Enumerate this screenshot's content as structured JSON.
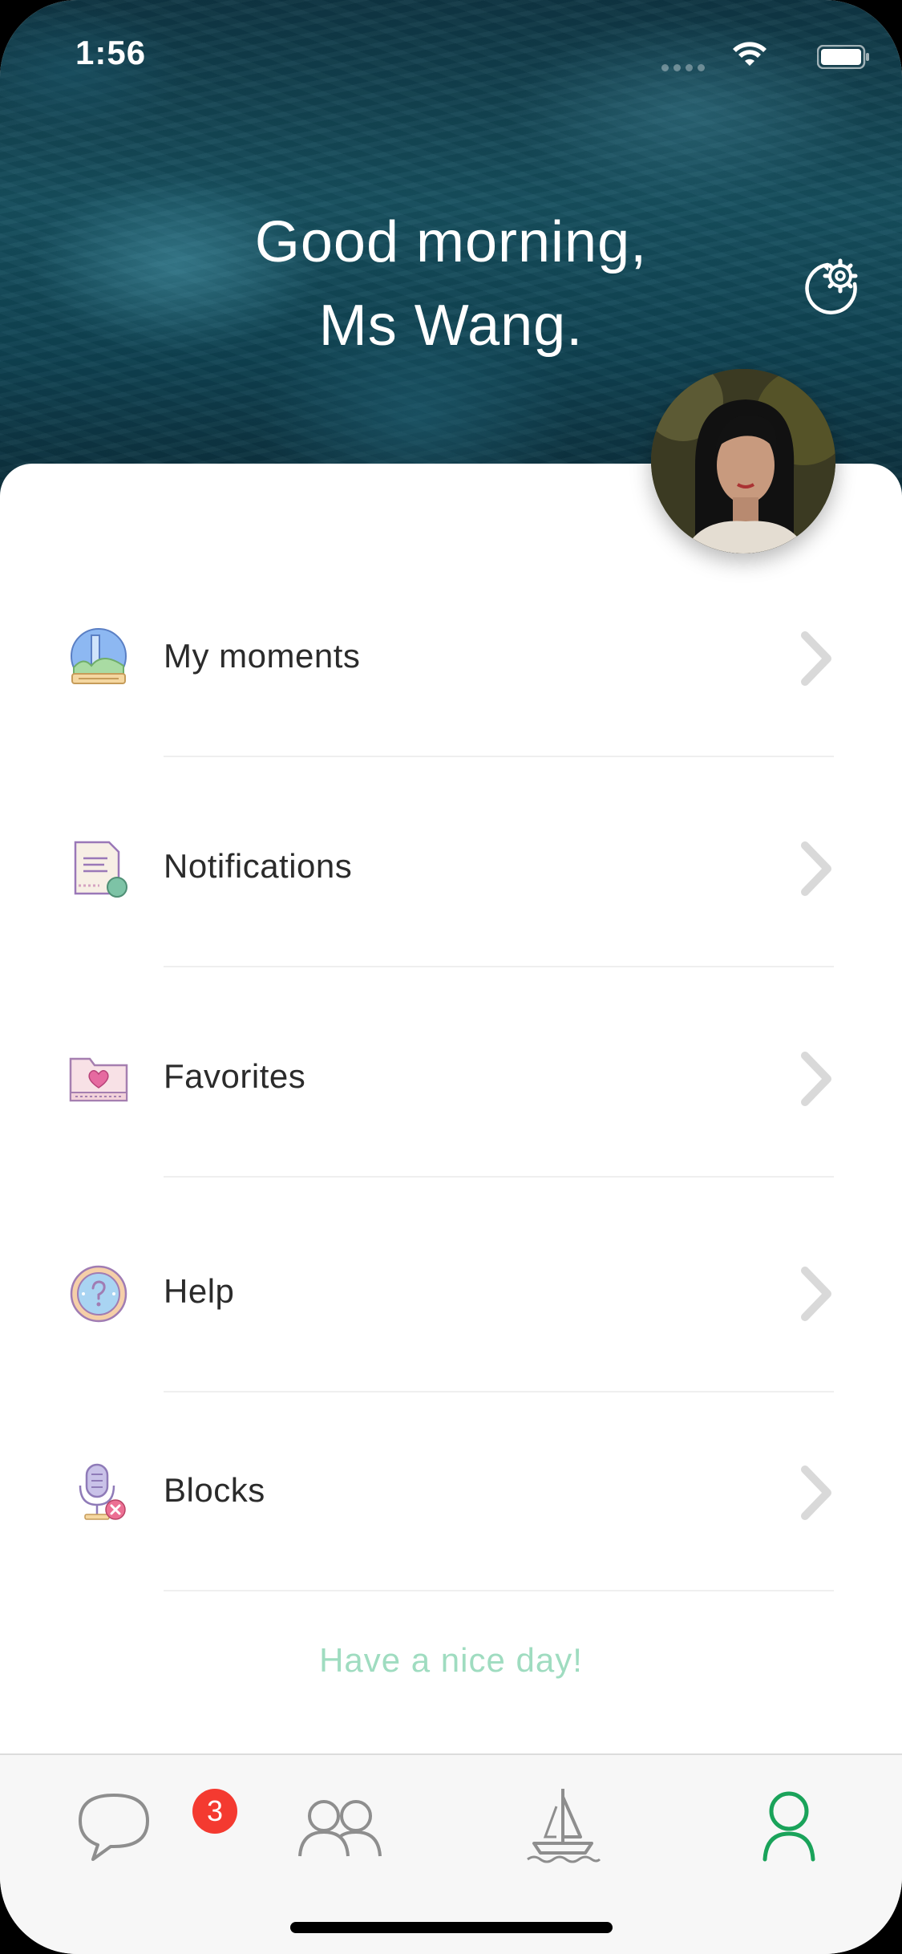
{
  "status_bar": {
    "time": "1:56"
  },
  "header": {
    "greeting_line1": "Good morning,",
    "greeting_line2": "Ms Wang.",
    "settings_icon": "gear-refresh-icon"
  },
  "menu": [
    {
      "label": "My moments",
      "icon": "moments-globe-icon"
    },
    {
      "label": "Notifications",
      "icon": "document-notification-icon"
    },
    {
      "label": "Favorites",
      "icon": "heart-folder-icon"
    },
    {
      "label": "Help",
      "icon": "question-compass-icon"
    },
    {
      "label": "Blocks",
      "icon": "microphone-block-icon"
    }
  ],
  "footer_note": "Have a nice day!",
  "tabbar": {
    "tabs": [
      {
        "name": "messages",
        "icon": "chat-bubble-icon",
        "badge": "3"
      },
      {
        "name": "contacts",
        "icon": "people-icon"
      },
      {
        "name": "discover",
        "icon": "sailboat-icon"
      },
      {
        "name": "me",
        "icon": "person-icon",
        "active": true
      }
    ]
  },
  "colors": {
    "accent": "#1aa35a",
    "badge": "#f43a30",
    "footer_text": "#9fdcc0",
    "inactive_icon": "#8e8e8e"
  }
}
